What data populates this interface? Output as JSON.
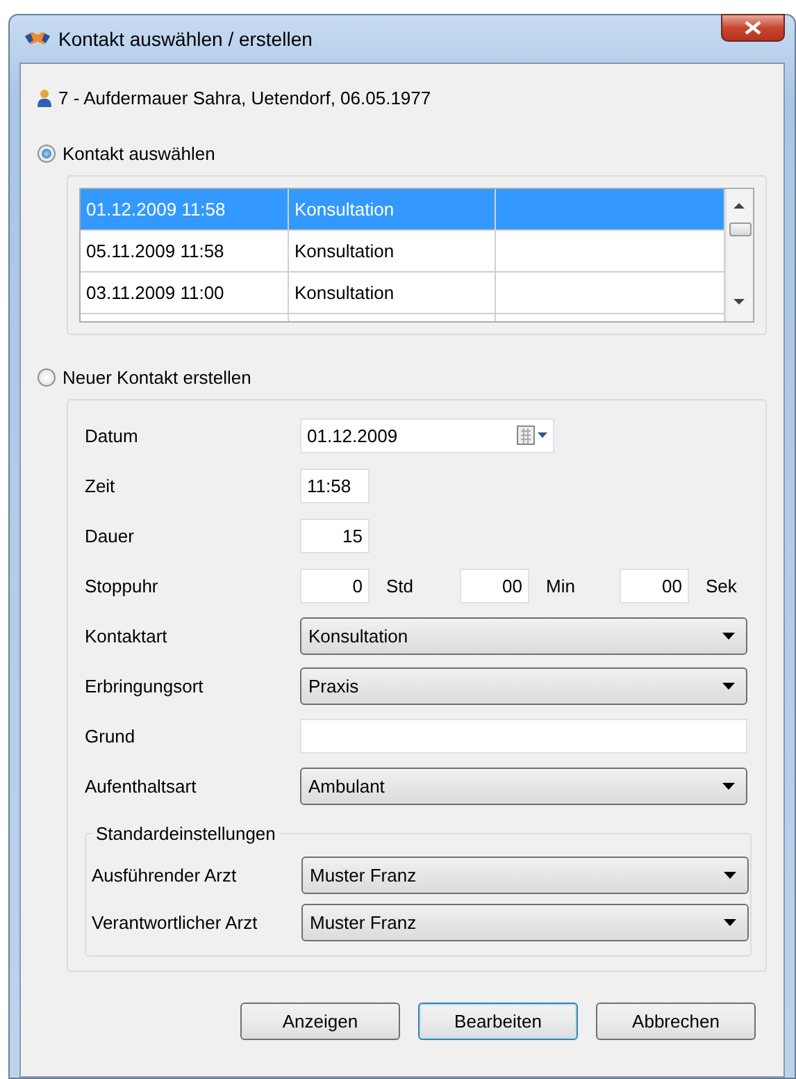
{
  "window": {
    "title": "Kontakt auswählen / erstellen"
  },
  "patient": "7 - Aufdermauer Sahra, Uetendorf, 06.05.1977",
  "modes": [
    {
      "label": "Kontakt auswählen",
      "selected": true
    },
    {
      "label": "Neuer Kontakt erstellen",
      "selected": false
    }
  ],
  "contacts": [
    {
      "cells": [
        "01.12.2009 11:58",
        "Konsultation"
      ],
      "selected": true
    },
    {
      "cells": [
        "05.11.2009 11:58",
        "Konsultation"
      ],
      "selected": false
    },
    {
      "cells": [
        "03.11.2009 11:00",
        "Konsultation"
      ],
      "selected": false
    }
  ],
  "form": [
    {
      "kind": "date",
      "label": "Datum",
      "value": "01.12.2009"
    },
    {
      "kind": "time",
      "label": "Zeit",
      "value": "11:58"
    },
    {
      "kind": "number",
      "label": "Dauer",
      "value": "15"
    },
    {
      "kind": "stopwatch",
      "label": "Stoppuhr",
      "parts": [
        {
          "value": "0",
          "unit": "Std"
        },
        {
          "value": "00",
          "unit": "Min"
        },
        {
          "value": "00",
          "unit": "Sek"
        }
      ]
    },
    {
      "kind": "combo",
      "label": "Kontaktart",
      "value": "Konsultation"
    },
    {
      "kind": "combo",
      "label": "Erbringungsort",
      "value": "Praxis"
    },
    {
      "kind": "text",
      "label": "Grund"
    },
    {
      "kind": "combo",
      "label": "Aufenthaltsart",
      "value": "Ambulant"
    }
  ],
  "defaults": {
    "title": "Standardeinstellungen",
    "fields": [
      {
        "label": "Ausführender Arzt",
        "value": "Muster Franz"
      },
      {
        "label": "Verantwortlicher Arzt",
        "value": "Muster Franz"
      }
    ]
  },
  "buttons": [
    {
      "label": "Anzeigen",
      "default": false
    },
    {
      "label": "Bearbeiten",
      "default": true
    },
    {
      "label": "Abbrechen",
      "default": false
    }
  ]
}
